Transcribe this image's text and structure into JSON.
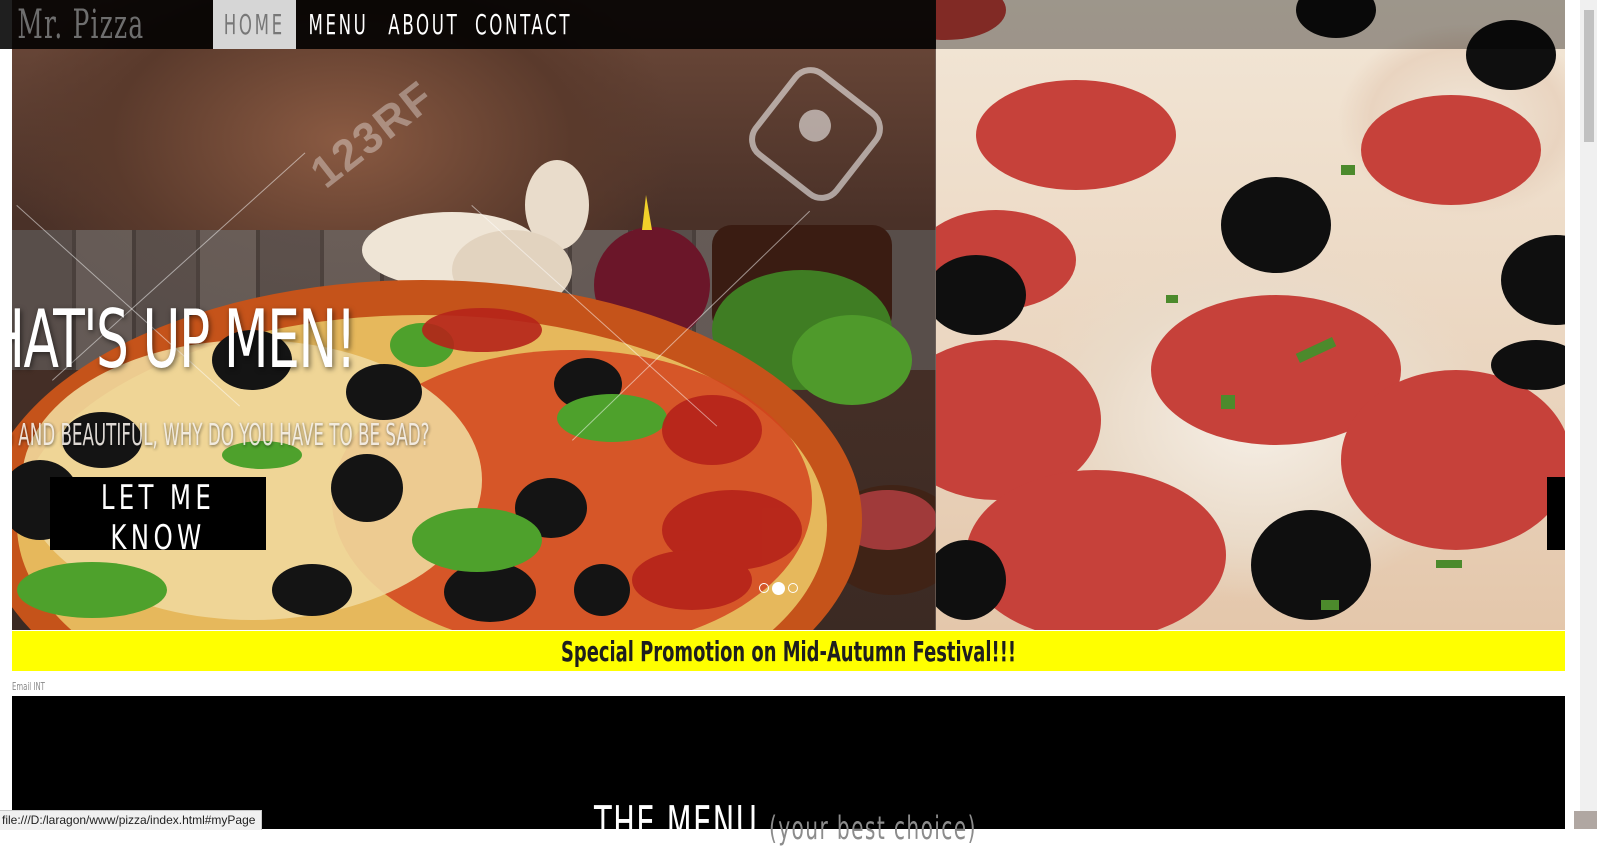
{
  "navbar": {
    "brand": "Mr. Pizza",
    "items": [
      {
        "label": "HOME",
        "active": true
      },
      {
        "label": "MENU",
        "active": false
      },
      {
        "label": "ABOUT",
        "active": false
      },
      {
        "label": "CONTACT",
        "active": false
      }
    ]
  },
  "hero": {
    "heading": "HAT'S UP MEN!",
    "subheading": "G AND BEAUTIFUL, WHY DO YOU HAVE TO BE SAD?",
    "cta_label": "LET ME KNOW",
    "watermark": "123RF",
    "slide_indicators": {
      "count": 3,
      "active_index": 1
    }
  },
  "promo": {
    "text": "Special Promotion on Mid-Autumn Festival!!!",
    "background_color": "#ffff00"
  },
  "email_label": "Email INT",
  "menu_section": {
    "title": "THE MENU",
    "subtitle": "(your best choice)"
  },
  "status_bar": {
    "url": "file:///D:/laragon/www/pizza/index.html#myPage"
  }
}
